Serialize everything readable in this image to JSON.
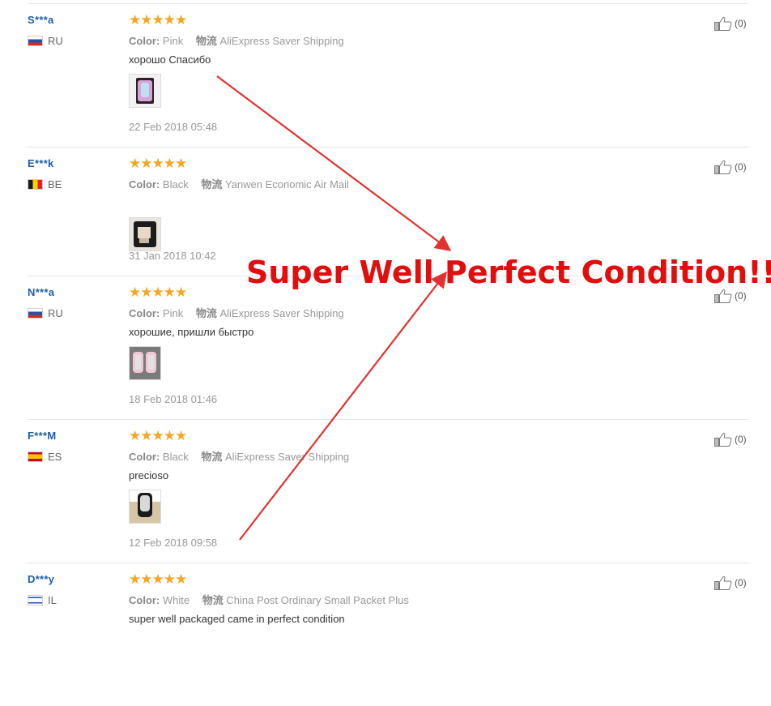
{
  "reviews": [
    {
      "user": "S***a",
      "country": "RU",
      "flag": "ru",
      "stars": "★★★★★",
      "rating": 5,
      "color_label": "Color:",
      "color_value": "Pink",
      "shipping_label": "物流",
      "shipping_value": "AliExpress Saver Shipping",
      "text": "хорошо Спасибо",
      "photo": "pink-case",
      "date": "22 Feb 2018 05:48",
      "helpful_count": "(0)"
    },
    {
      "user": "E***k",
      "country": "BE",
      "flag": "be",
      "stars": "★★★★★",
      "rating": 5,
      "color_label": "Color:",
      "color_value": "Black",
      "shipping_label": "物流",
      "shipping_value": "Yanwen Economic Air Mail",
      "text": "",
      "photo": "black-case",
      "date": "31 Jan 2018 10:42",
      "helpful_count": "(0)"
    },
    {
      "user": "N***a",
      "country": "RU",
      "flag": "ru",
      "stars": "★★★★★",
      "rating": 5,
      "color_label": "Color:",
      "color_value": "Pink",
      "shipping_label": "物流",
      "shipping_value": "AliExpress Saver Shipping",
      "text": "хорошие, пришли быстро",
      "photo": "pink-pair",
      "date": "18 Feb 2018 01:46",
      "helpful_count": "(0)"
    },
    {
      "user": "F***M",
      "country": "ES",
      "flag": "es",
      "stars": "★★★★★",
      "rating": 5,
      "color_label": "Color:",
      "color_value": "Black",
      "shipping_label": "物流",
      "shipping_value": "AliExpress Saver Shipping",
      "text": "precioso",
      "photo": "black-phone",
      "date": "12 Feb 2018 09:58",
      "helpful_count": "(0)"
    },
    {
      "user": "D***y",
      "country": "IL",
      "flag": "il",
      "stars": "★★★★★",
      "rating": 5,
      "color_label": "Color:",
      "color_value": "White",
      "shipping_label": "物流",
      "shipping_value": "China Post Ordinary Small Packet Plus",
      "text": "super well packaged came in perfect condition",
      "photo": "",
      "date": "",
      "helpful_count": "(0)"
    }
  ],
  "icons": {
    "helpful": "thumbs-up-icon",
    "rating": "star-icon"
  },
  "overlay": {
    "banner": "Super Well Perfect Condition!!",
    "color": "#e30d0d"
  },
  "colors": {
    "username": "#1d5fa8",
    "stars": "#f6a623",
    "muted": "#999999"
  }
}
